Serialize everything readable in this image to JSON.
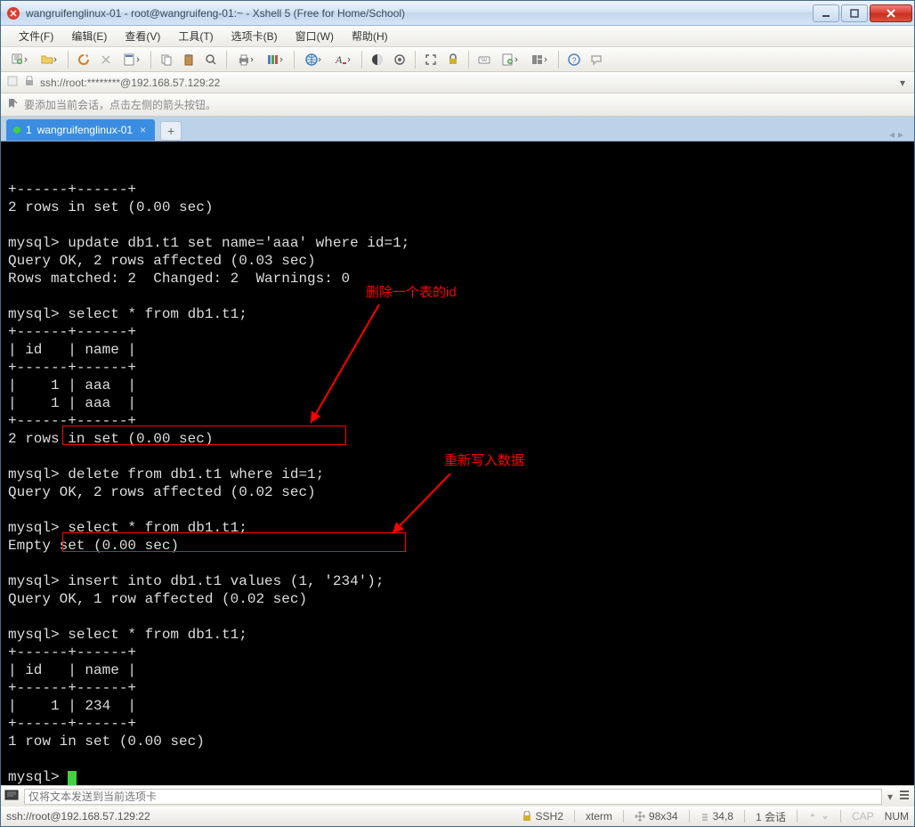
{
  "window": {
    "title": "wangruifenglinux-01 - root@wangruifeng-01:~ - Xshell 5 (Free for Home/School)"
  },
  "menu": {
    "file": "文件(F)",
    "edit": "编辑(E)",
    "view": "查看(V)",
    "tools": "工具(T)",
    "tabs": "选项卡(B)",
    "window": "窗口(W)",
    "help": "帮助(H)"
  },
  "address": {
    "text": "ssh://root:********@192.168.57.129:22"
  },
  "hint": {
    "text": "要添加当前会话，点击左侧的箭头按钮。"
  },
  "tab": {
    "index": "1",
    "name": "wangruifenglinux-01"
  },
  "terminal": {
    "lines": [
      "+------+------+",
      "2 rows in set (0.00 sec)",
      "",
      "mysql> update db1.t1 set name='aaa' where id=1;",
      "Query OK, 2 rows affected (0.03 sec)",
      "Rows matched: 2  Changed: 2  Warnings: 0",
      "",
      "mysql> select * from db1.t1;",
      "+------+------+",
      "| id   | name |",
      "+------+------+",
      "|    1 | aaa  |",
      "|    1 | aaa  |",
      "+------+------+",
      "2 rows in set (0.00 sec)",
      "",
      "mysql> delete from db1.t1 where id=1;",
      "Query OK, 2 rows affected (0.02 sec)",
      "",
      "mysql> select * from db1.t1;",
      "Empty set (0.00 sec)",
      "",
      "mysql> insert into db1.t1 values (1, '234');",
      "Query OK, 1 row affected (0.02 sec)",
      "",
      "mysql> select * from db1.t1;",
      "+------+------+",
      "| id   | name |",
      "+------+------+",
      "|    1 | 234  |",
      "+------+------+",
      "1 row in set (0.00 sec)",
      "",
      "mysql> "
    ],
    "annotation1": "删除一个表的id",
    "annotation2": "重新写入数据"
  },
  "sendbar": {
    "placeholder": "仅将文本发送到当前选项卡"
  },
  "status": {
    "conn": "ssh://root@192.168.57.129:22",
    "proto": "SSH2",
    "term": "xterm",
    "size": "98x34",
    "pos": "34,8",
    "sessions": "1 会话",
    "cap": "CAP",
    "num": "NUM"
  }
}
